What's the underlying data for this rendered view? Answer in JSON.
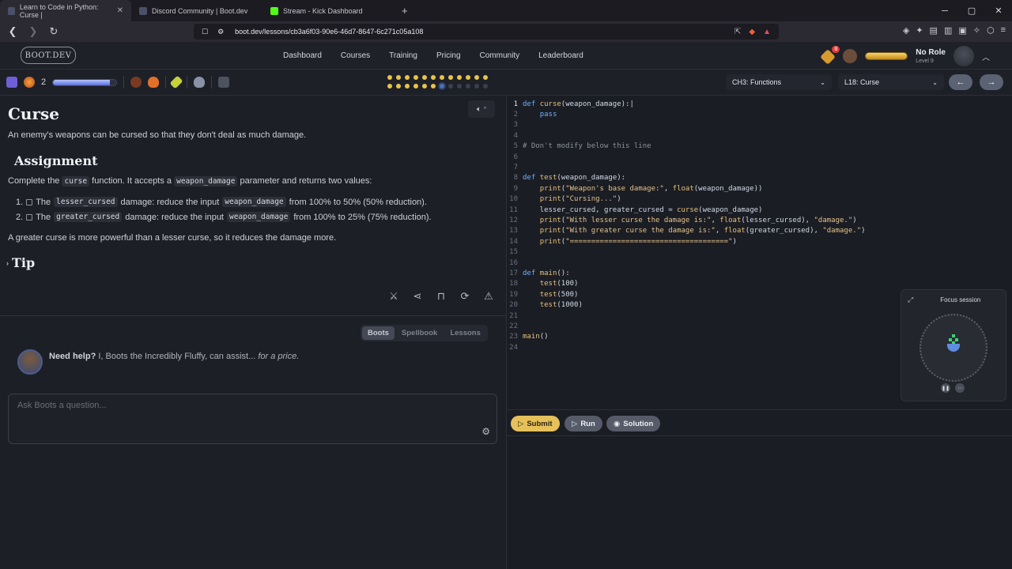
{
  "browser": {
    "tabs": [
      {
        "title": "Learn to Code in Python: Curse |",
        "active": true
      },
      {
        "title": "Discord Community | Boot.dev",
        "active": false
      },
      {
        "title": "Stream - Kick Dashboard",
        "active": false
      }
    ],
    "new_tab": "+",
    "url": "boot.dev/lessons/cb3a6f03-90e6-46d7-8647-6c271c05a108"
  },
  "site": {
    "logo": "BOOT.DEV",
    "nav": [
      "Dashboard",
      "Courses",
      "Training",
      "Pricing",
      "Community",
      "Leaderboard"
    ],
    "gem_count": "8",
    "user_role": "No Role",
    "user_level": "Level 9"
  },
  "lesson_bar": {
    "level": "2",
    "xp_fraction": 0.9,
    "chapter": "CH3: Functions",
    "lesson": "L18: Curse",
    "progress_dots": [
      "on",
      "on",
      "on",
      "on",
      "on",
      "on",
      "on",
      "on",
      "on",
      "on",
      "on",
      "on",
      "on",
      "on",
      "on",
      "on",
      "on",
      "on",
      "cur",
      "off",
      "off",
      "off",
      "off",
      "off"
    ]
  },
  "lesson": {
    "title": "Curse",
    "intro": "An enemy's weapons can be cursed so that they don't deal as much damage.",
    "assignment_heading": "Assignment",
    "assignment": {
      "pre": "Complete the ",
      "func": "curse",
      "mid": " function. It accepts a ",
      "param": "weapon_damage",
      "post": " parameter and returns two values:"
    },
    "tasks": [
      {
        "num": "1.",
        "pre": "The ",
        "var": "lesser_cursed",
        "mid": " damage: reduce the input ",
        "param": "weapon_damage",
        "post": " from 100% to 50% (50% reduction)."
      },
      {
        "num": "2.",
        "pre": "The ",
        "var": "greater_cursed",
        "mid": " damage: reduce the input ",
        "param": "weapon_damage",
        "post": " from 100% to 25% (75% reduction)."
      }
    ],
    "summary": "A greater curse is more powerful than a lesser curse, so it reduces the damage more.",
    "tip_heading": "Tip"
  },
  "chat": {
    "tabs": [
      "Boots",
      "Spellbook",
      "Lessons"
    ],
    "help_bold": "Need help?",
    "help_text": " I, Boots the Incredibly Fluffy, can assist... ",
    "help_italic": "for a price.",
    "placeholder": "Ask Boots a question..."
  },
  "editor": {
    "lines": [
      "def curse(weapon_damage):",
      "    pass",
      "",
      "",
      "# Don't modify below this line",
      "",
      "",
      "def test(weapon_damage):",
      "    print(\"Weapon's base damage:\", float(weapon_damage))",
      "    print(\"Cursing...\")",
      "    lesser_cursed, greater_cursed = curse(weapon_damage)",
      "    print(\"With lesser curse the damage is:\", float(lesser_cursed), \"damage.\")",
      "    print(\"With greater curse the damage is:\", float(greater_cursed), \"damage.\")",
      "    print(\"=====================================\")",
      "",
      "",
      "def main():",
      "    test(100)",
      "    test(500)",
      "    test(1000)",
      "",
      "",
      "main()",
      ""
    ],
    "submit": "Submit",
    "run": "Run",
    "solution": "Solution"
  },
  "focus": {
    "title": "Focus session"
  }
}
